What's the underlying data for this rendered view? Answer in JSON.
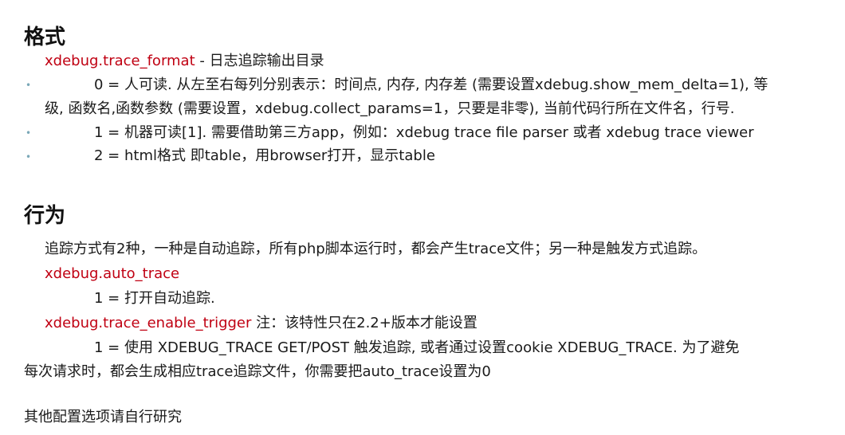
{
  "format_section": {
    "heading": "格式",
    "key": "xdebug.trace_format",
    "key_desc": " - 日志追踪输出目录",
    "bullets": [
      {
        "first": "0 = 人可读. 从左至右每列分别表示：时间点, 内存, 内存差 (需要设置xdebug.show_mem_delta=1), 等",
        "cont": "级, 函数名,函数参数 (需要设置，xdebug.collect_params=1，只要是非零), 当前代码行所在文件名，行号."
      },
      {
        "first": "1 = 机器可读[1]. 需要借助第三方app，例如：xdebug trace file parser 或者 xdebug trace viewer"
      },
      {
        "first": "2 = html格式 即table，用browser打开，显示table"
      }
    ]
  },
  "behavior_section": {
    "heading": "行为",
    "intro": "追踪方式有2种，一种是自动追踪，所有php脚本运行时，都会产生trace文件；另一种是触发方式追踪。",
    "auto_trace_key": "xdebug.auto_trace",
    "auto_trace_value": "1 = 打开自动追踪.",
    "trigger_key": "xdebug.trace_enable_trigger",
    "trigger_note": "  注：该特性只在2.2+版本才能设置",
    "trigger_value_line1": "1 = 使用 XDEBUG_TRACE GET/POST 触发追踪, 或者通过设置cookie XDEBUG_TRACE. 为了避免",
    "trigger_value_line2": "每次请求时，都会生成相应trace追踪文件，你需要把auto_trace设置为0"
  },
  "footer": {
    "text": "其他配置选项请自行研究"
  },
  "colors": {
    "key": "#c00012",
    "bullet": "#7aa8b8",
    "text": "#1a1a1a"
  },
  "bullet_glyph": "•"
}
